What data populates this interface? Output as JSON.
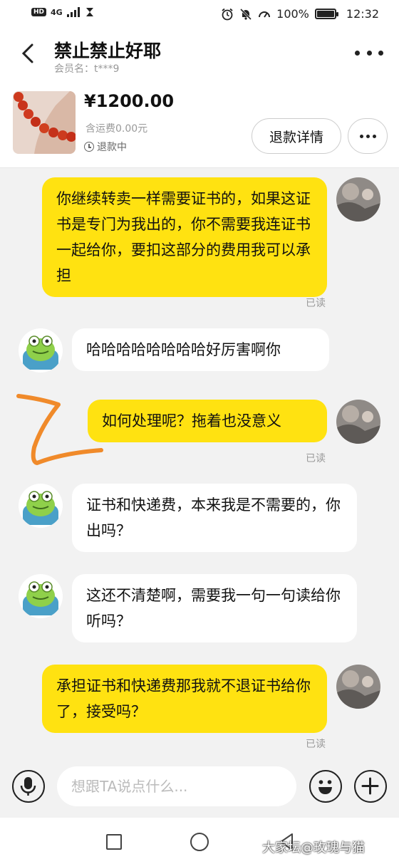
{
  "status_bar": {
    "network": "4G",
    "battery": "100%",
    "battery_level": 1.0,
    "time": "12:32"
  },
  "header": {
    "title": "禁止禁止好耶",
    "member": "会员名：t***9"
  },
  "order": {
    "price": "¥1200.00",
    "shipping": "含运费0.00元",
    "status": "退款中",
    "refund_button": "退款详情"
  },
  "messages": [
    {
      "from": "me",
      "text": "你继续转卖一样需要证书的，如果这证书是专门为我出的，你不需要我连证书一起给你，要扣这部分的费用我可以承担",
      "status": "已读"
    },
    {
      "from": "them",
      "text": "哈哈哈哈哈哈哈哈好厉害啊你"
    },
    {
      "from": "me",
      "text": "如何处理呢？拖着也没意义",
      "status": "已读"
    },
    {
      "from": "them",
      "text": "证书和快递费，本来我是不需要的，你出吗？"
    },
    {
      "from": "them",
      "text": "这还不清楚啊，需要我一句一句读给你听吗？"
    },
    {
      "from": "me",
      "text": "承担证书和快递费那我就不退证书给你了，接受吗？",
      "status": "已读"
    }
  ],
  "input": {
    "placeholder": "想跟TA说点什么..."
  },
  "watermark": "大家坛@玫瑰与猫",
  "colors": {
    "my_bubble": "#ffe211",
    "their_bubble": "#ffffff",
    "background": "#f2f2f2",
    "annotation": "#f08a2a"
  }
}
